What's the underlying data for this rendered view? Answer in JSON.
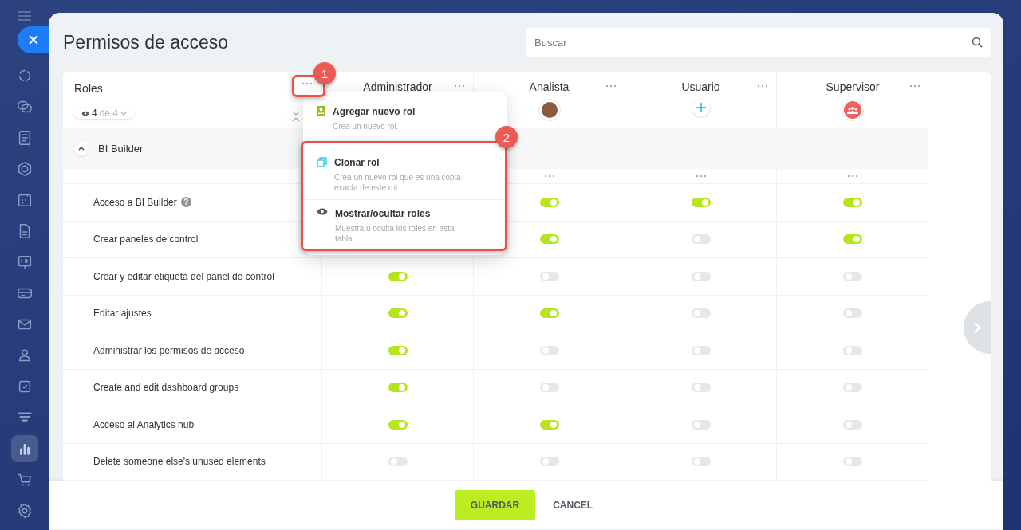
{
  "sidebar": {
    "items": [
      {
        "kind": "loop",
        "selected": false
      },
      {
        "kind": "chat",
        "selected": false
      },
      {
        "kind": "doc",
        "selected": false
      },
      {
        "kind": "hex",
        "selected": false
      },
      {
        "kind": "calendar",
        "selected": false
      },
      {
        "kind": "file",
        "selected": false
      },
      {
        "kind": "board",
        "selected": false
      },
      {
        "kind": "card",
        "selected": false
      },
      {
        "kind": "mail",
        "selected": false
      },
      {
        "kind": "people",
        "selected": false
      },
      {
        "kind": "check",
        "selected": false
      },
      {
        "kind": "funnel",
        "selected": false
      },
      {
        "kind": "chart",
        "selected": true
      },
      {
        "kind": "cart",
        "selected": false
      },
      {
        "kind": "gear",
        "selected": false
      }
    ]
  },
  "window": {
    "title": "Permisos de acceso"
  },
  "search": {
    "placeholder": "Buscar"
  },
  "table": {
    "roles_label": "Roles",
    "filter": {
      "count": "4",
      "total": "de 4"
    },
    "columns": [
      {
        "name": "Administrador"
      },
      {
        "name": "Analista",
        "kind": "photo"
      },
      {
        "name": "Usuario",
        "kind": "add"
      },
      {
        "name": "Supervisor",
        "kind": "group"
      }
    ],
    "section": {
      "title": "BI Builder",
      "expanded": true
    },
    "rows": [
      {
        "label": "Acceso a BI Builder",
        "help": "?",
        "values": [
          true,
          true,
          true
        ]
      },
      {
        "label": "Crear paneles de control",
        "values": [
          true,
          false,
          true
        ]
      },
      {
        "label": "Crear y editar etiqueta del panel de control",
        "values": [
          true,
          false,
          false,
          false
        ]
      },
      {
        "label": "Editar ajustes",
        "values": [
          true,
          true,
          false,
          false
        ]
      },
      {
        "label": "Administrar los permisos de acceso",
        "values": [
          true,
          false,
          false,
          false
        ]
      },
      {
        "label": "Create and edit dashboard groups",
        "values": [
          true,
          false,
          false,
          false
        ]
      },
      {
        "label": "Acceso al Analytics hub",
        "values": [
          true,
          true,
          false,
          false
        ]
      },
      {
        "label": "Delete someone else's unused elements",
        "values": [
          false,
          false,
          false,
          false
        ]
      }
    ]
  },
  "menu": {
    "items": [
      {
        "kind": "add",
        "title": "Agregar nuevo rol",
        "description": "Crea un nuevo rol."
      },
      {
        "kind": "clone",
        "title": "Clonar rol",
        "description": "Crea un nuevo rol que es una copia exacta de este rol."
      },
      {
        "kind": "eye",
        "title": "Mostrar/ocultar roles",
        "description": "Muestra u oculta los roles en esta tabla."
      }
    ]
  },
  "annotations": [
    {
      "number": "1"
    },
    {
      "number": "2"
    }
  ],
  "footer": {
    "buttons": [
      {
        "label": "GUARDAR",
        "kind": "primary"
      },
      {
        "label": "CANCEL",
        "kind": "link"
      }
    ]
  }
}
